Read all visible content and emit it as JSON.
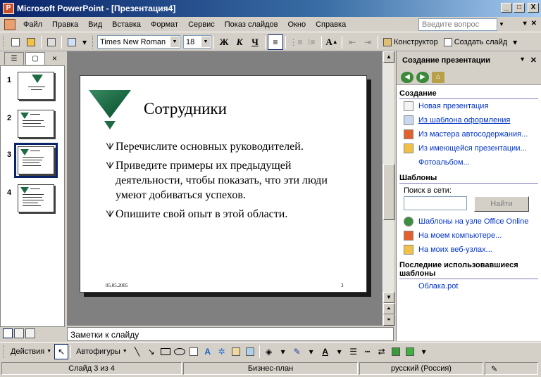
{
  "window": {
    "title": "Microsoft PowerPoint - [Презентация4]",
    "app_icon": "P",
    "min_label": "_",
    "max_label": "□",
    "close_label": "X"
  },
  "menu": {
    "items": [
      "Файл",
      "Правка",
      "Вид",
      "Вставка",
      "Формат",
      "Сервис",
      "Показ слайдов",
      "Окно",
      "Справка"
    ],
    "ask_placeholder": "Введите вопрос",
    "doc_controls": [
      "▾",
      "✕"
    ]
  },
  "toolbar": {
    "font_name": "Times New Roman",
    "font_size": "18",
    "bold": "Ж",
    "italic": "К",
    "underline": "Ч",
    "designer_label": "Конструктор",
    "new_slide_label": "Создать слайд"
  },
  "left_pane": {
    "tab_outline": "☰",
    "tab_slides": "▢",
    "close": "×",
    "slide_numbers": [
      "1",
      "2",
      "3",
      "4"
    ],
    "selected_index": 3
  },
  "slide": {
    "title": "Сотрудники",
    "bullet_mark": "ᗐ",
    "bullets": [
      "Перечислите основных руководителей.",
      "Приведите примеры их предыдущей деятельности, чтобы показать, что эти люди умеют добиваться успехов.",
      "Опишите свой опыт в этой области."
    ],
    "date": "05.05.2005",
    "page": "3",
    "accent_color": "#1d6b45"
  },
  "notes": {
    "placeholder": "Заметки к слайду"
  },
  "task_pane": {
    "title": "Создание презентации",
    "create_section": "Создание",
    "create_links": [
      "Новая презентация",
      "Из шаблона оформления",
      "Из мастера автосодержания...",
      "Из имеющейся презентации...",
      "Фотоальбом..."
    ],
    "templates_section": "Шаблоны",
    "search_label": "Поиск в сети:",
    "search_button": "Найти",
    "template_links": [
      "Шаблоны на узле Office Online",
      "На моем компьютере...",
      "На моих веб-узлах..."
    ],
    "recent_section": "Последние использовавшиеся шаблоны",
    "recent_links": [
      "Облака.pot"
    ]
  },
  "drawing_toolbar": {
    "actions_label": "Действия",
    "autoshapes_label": "Автофигуры"
  },
  "status": {
    "slide": "Слайд 3 из 4",
    "design": "Бизнес-план",
    "language": "русский (Россия)"
  }
}
